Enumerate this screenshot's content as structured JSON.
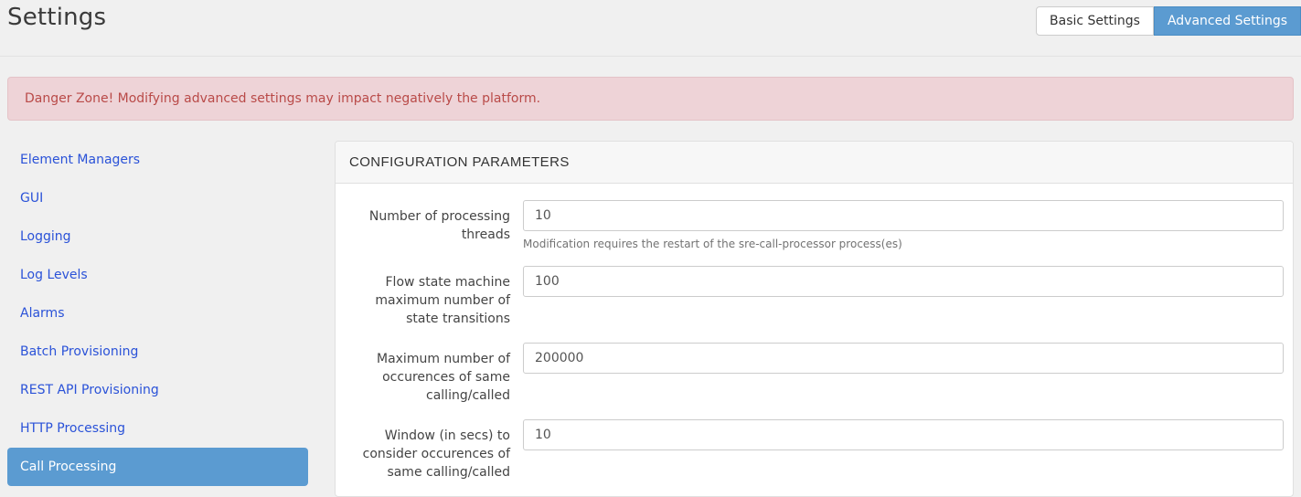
{
  "header": {
    "title": "Settings",
    "toggle": {
      "basic_label": "Basic Settings",
      "advanced_label": "Advanced Settings",
      "active": "Advanced Settings"
    }
  },
  "banner": {
    "text": "Danger Zone! Modifying advanced settings may impact negatively the platform.",
    "text_color": "#b94a48",
    "background": "#eed3d7"
  },
  "sidebar": {
    "items": [
      {
        "label": "Element Managers",
        "active": false
      },
      {
        "label": "GUI",
        "active": false
      },
      {
        "label": "Logging",
        "active": false
      },
      {
        "label": "Log Levels",
        "active": false
      },
      {
        "label": "Alarms",
        "active": false
      },
      {
        "label": "Batch Provisioning",
        "active": false
      },
      {
        "label": "REST API Provisioning",
        "active": false
      },
      {
        "label": "HTTP Processing",
        "active": false
      },
      {
        "label": "Call Processing",
        "active": true
      }
    ],
    "link_color": "#2a52d8",
    "active_background": "#5b9bd1"
  },
  "panel": {
    "title": "CONFIGURATION PARAMETERS",
    "fields": [
      {
        "label": "Number of processing threads",
        "value": "10",
        "help": "Modification requires the restart of the sre-call-processor process(es)"
      },
      {
        "label": "Flow state machine maximum number of state transitions",
        "value": "100",
        "help": ""
      },
      {
        "label": "Maximum number of occurences of same calling/called",
        "value": "200000",
        "help": ""
      },
      {
        "label": "Window (in secs) to consider occurences of same calling/called",
        "value": "10",
        "help": ""
      }
    ]
  },
  "colors": {
    "accent": "#5b9bd1",
    "page_background": "#f0f0f0",
    "panel_background": "#ffffff"
  }
}
